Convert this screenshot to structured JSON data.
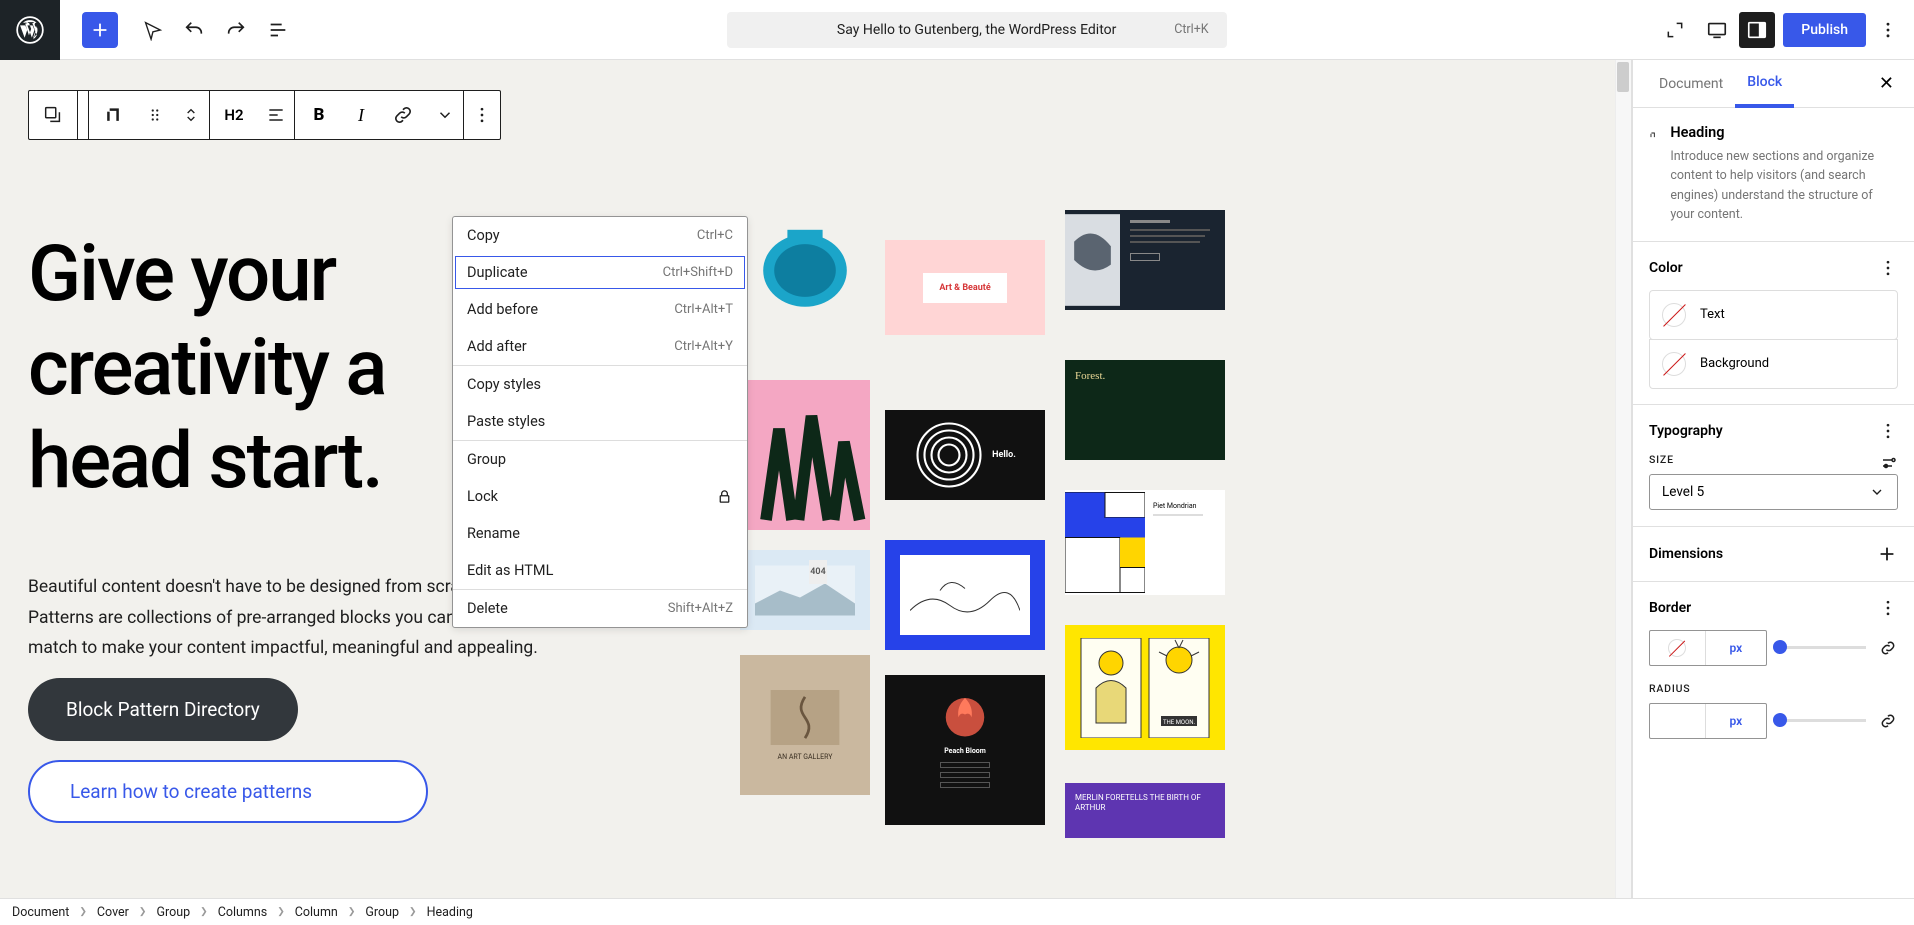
{
  "header": {
    "command_title": "Say Hello to Gutenberg, the WordPress Editor",
    "command_shortcut": "Ctrl+K",
    "publish_label": "Publish"
  },
  "canvas": {
    "heading": "Give your creativity a head start.",
    "paragraph": "Beautiful content doesn't have to be designed from scratch. Block Patterns are collections of pre-arranged blocks you can mix and match to make your content impactful, meaningful and appealing.",
    "button_primary": "Block Pattern Directory",
    "button_secondary": "Learn how to create patterns"
  },
  "block_toolbar": {
    "heading_level": "H2"
  },
  "context_menu": {
    "items": [
      {
        "label": "Copy",
        "shortcut": "Ctrl+C"
      },
      {
        "label": "Duplicate",
        "shortcut": "Ctrl+Shift+D",
        "focused": true
      },
      {
        "label": "Add before",
        "shortcut": "Ctrl+Alt+T"
      },
      {
        "label": "Add after",
        "shortcut": "Ctrl+Alt+Y"
      }
    ],
    "second": [
      {
        "label": "Copy styles"
      },
      {
        "label": "Paste styles"
      }
    ],
    "third": [
      {
        "label": "Group"
      },
      {
        "label": "Lock",
        "icon": "lock"
      },
      {
        "label": "Rename"
      },
      {
        "label": "Edit as HTML"
      }
    ],
    "fourth": [
      {
        "label": "Delete",
        "shortcut": "Shift+Alt+Z"
      }
    ]
  },
  "sidebar": {
    "tabs": {
      "document": "Document",
      "block": "Block"
    },
    "block": {
      "title": "Heading",
      "description": "Introduce new sections and organize content to help visitors (and search engines) understand the structure of your content."
    },
    "color": {
      "title": "Color",
      "text": "Text",
      "background": "Background"
    },
    "typography": {
      "title": "Typography",
      "size_label": "Size",
      "size_value": "Level 5"
    },
    "dimensions": {
      "title": "Dimensions"
    },
    "border": {
      "title": "Border",
      "unit": "px",
      "radius_label": "Radius",
      "radius_unit": "px"
    }
  },
  "gallery": {
    "items": [
      {
        "label": "Art & Beauté",
        "bg": "#ff4f4f"
      },
      {
        "label": "Forest.",
        "bg": "#173518"
      },
      {
        "label": "Hello.",
        "bg": "#111"
      },
      {
        "label": "404",
        "bg": "#eee"
      },
      {
        "label": "Piet Mondrian",
        "bg": "#fff"
      },
      {
        "label": "Peach Bloom",
        "bg": "#111"
      },
      {
        "label": "AN ART GALLERY",
        "bg": "#cab89f"
      },
      {
        "label": "THE MOON.",
        "bg": "#ffe600"
      },
      {
        "label": "MERLIN FORETELLS THE BIRTH OF ARTHUR",
        "bg": "#5e35b1"
      }
    ]
  },
  "breadcrumb": [
    "Document",
    "Cover",
    "Group",
    "Columns",
    "Column",
    "Group",
    "Heading"
  ]
}
